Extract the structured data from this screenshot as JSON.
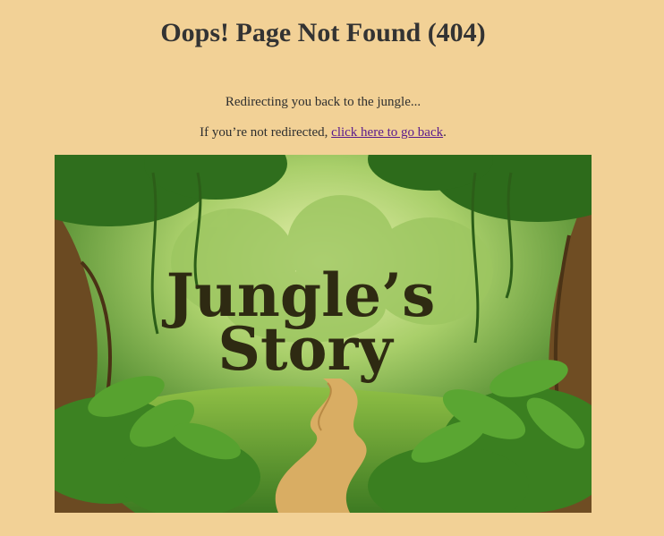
{
  "page": {
    "title": "Oops! Page Not Found (404)",
    "redirect_message": "Redirecting you back to the jungle...",
    "fallback_prefix": "If you’re not redirected, ",
    "fallback_link": "click here to go back",
    "fallback_suffix": "."
  },
  "hero_image": {
    "logo_line1": "Jungle’s",
    "logo_line2": "Story",
    "description": "Watercolor jungle scene with dirt path"
  },
  "colors": {
    "background": "#f2d196",
    "link": "#5a1a8c",
    "title": "#333333"
  }
}
